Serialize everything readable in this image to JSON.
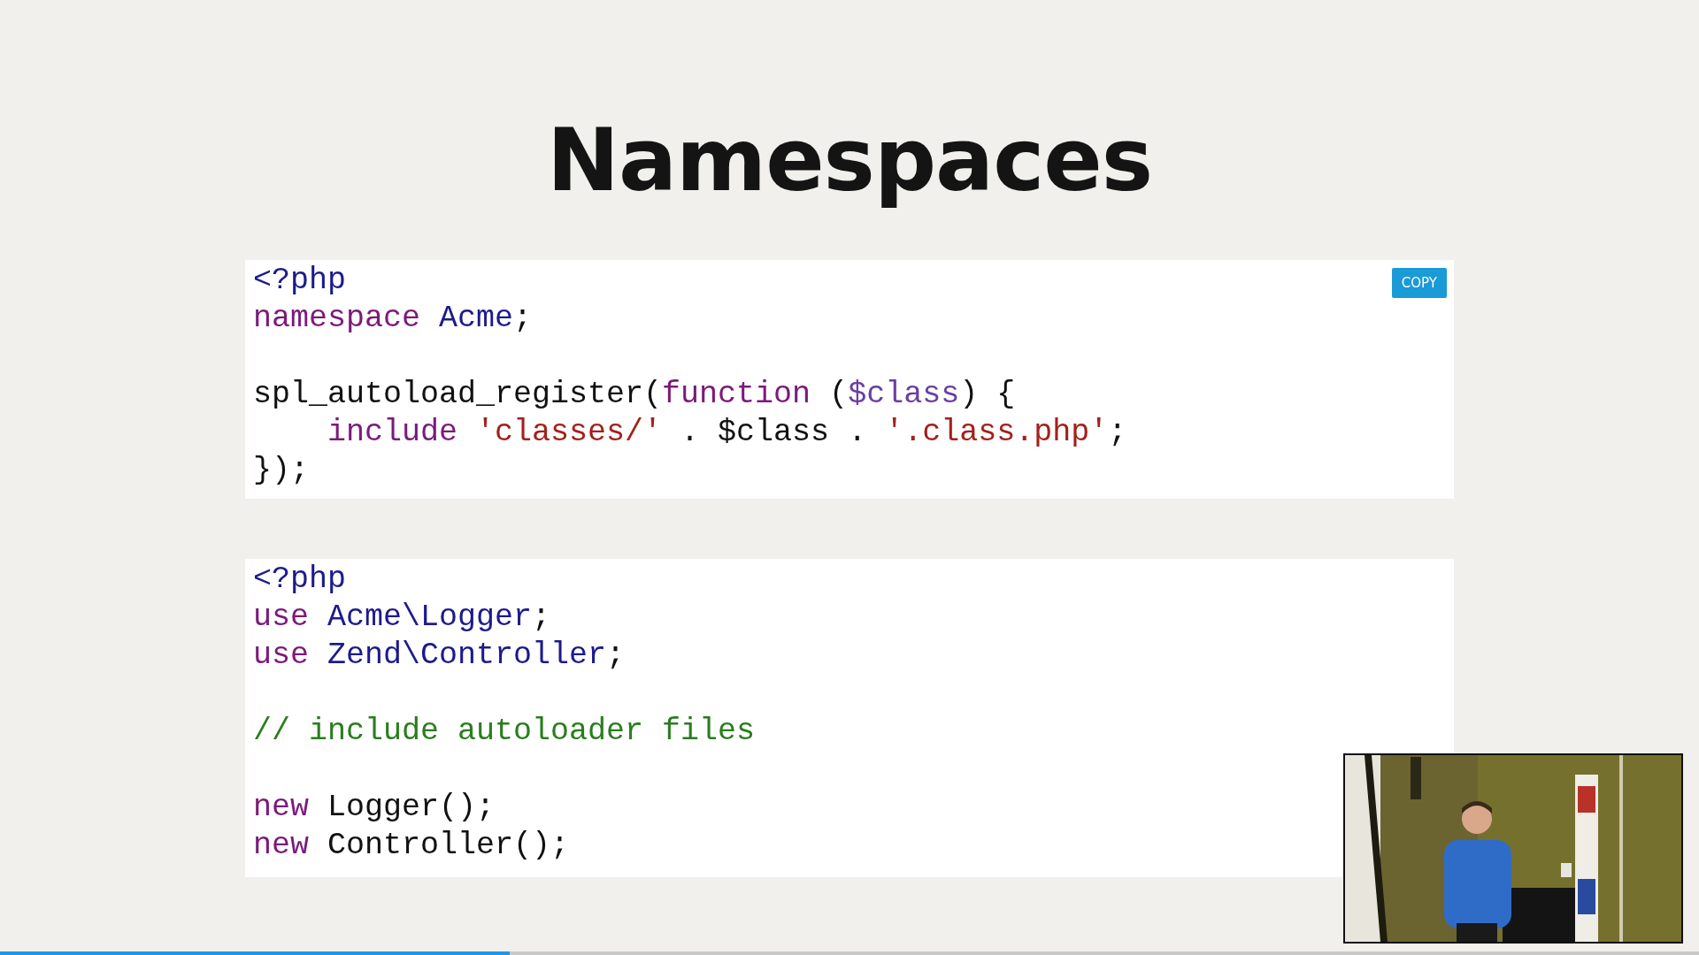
{
  "slide": {
    "title": "Namespaces",
    "code_blocks": [
      {
        "copy_button": "COPY",
        "lines": [
          {
            "kind": "code",
            "tokens": [
              {
                "kind": "name",
                "text": "<?php"
              }
            ]
          },
          {
            "kind": "code",
            "tokens": [
              {
                "kind": "keyword",
                "text": "namespace "
              },
              {
                "kind": "name",
                "text": "Acme"
              },
              {
                "kind": "plain",
                "text": ";"
              }
            ]
          },
          {
            "kind": "blank"
          },
          {
            "kind": "code",
            "tokens": [
              {
                "kind": "plain",
                "text": "spl_autoload_register("
              },
              {
                "kind": "keyword",
                "text": "function"
              },
              {
                "kind": "plain",
                "text": " ("
              },
              {
                "kind": "variable",
                "text": "$class"
              },
              {
                "kind": "plain",
                "text": ") {"
              }
            ]
          },
          {
            "kind": "code",
            "tokens": [
              {
                "kind": "keyword",
                "text": "    include "
              },
              {
                "kind": "string",
                "text": "'classes/'"
              },
              {
                "kind": "plain",
                "text": " . $class . "
              },
              {
                "kind": "string",
                "text": "'.class.php'"
              },
              {
                "kind": "plain",
                "text": ";"
              }
            ]
          },
          {
            "kind": "code",
            "tokens": [
              {
                "kind": "plain",
                "text": "});"
              }
            ]
          }
        ]
      },
      {
        "lines": [
          {
            "kind": "code",
            "tokens": [
              {
                "kind": "name",
                "text": "<?php"
              }
            ]
          },
          {
            "kind": "code",
            "tokens": [
              {
                "kind": "keyword",
                "text": "use "
              },
              {
                "kind": "name",
                "text": "Acme\\Logger"
              },
              {
                "kind": "plain",
                "text": ";"
              }
            ]
          },
          {
            "kind": "code",
            "tokens": [
              {
                "kind": "keyword",
                "text": "use "
              },
              {
                "kind": "name",
                "text": "Zend\\Controller"
              },
              {
                "kind": "plain",
                "text": ";"
              }
            ]
          },
          {
            "kind": "blank"
          },
          {
            "kind": "code",
            "tokens": [
              {
                "kind": "comment",
                "text": "// include autoloader files"
              }
            ]
          },
          {
            "kind": "blank"
          },
          {
            "kind": "code",
            "tokens": [
              {
                "kind": "keyword",
                "text": "new"
              },
              {
                "kind": "plain",
                "text": " Logger();"
              }
            ]
          },
          {
            "kind": "code",
            "tokens": [
              {
                "kind": "keyword",
                "text": "new"
              },
              {
                "kind": "plain",
                "text": " Controller();"
              }
            ]
          }
        ]
      }
    ]
  },
  "progress": {
    "level": 0.3
  }
}
